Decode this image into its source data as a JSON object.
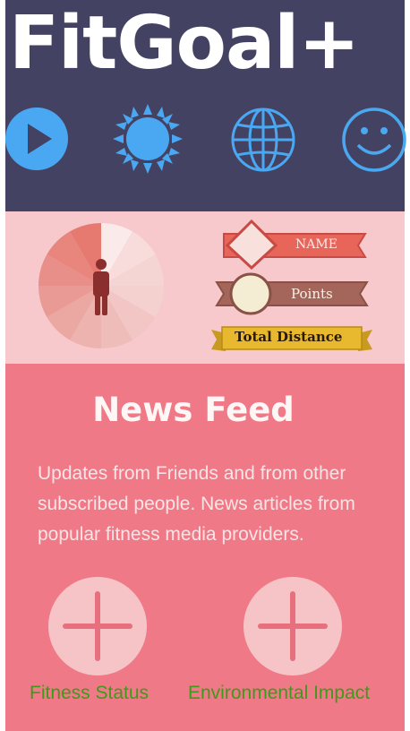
{
  "header": {
    "title": "FitGoal+",
    "icons": [
      "play-icon",
      "sun-icon",
      "globe-icon",
      "smiley-icon"
    ]
  },
  "profile": {
    "avatar_icon": "person-icon",
    "name_label": "NAME",
    "points_label": "Points",
    "distance_label": "Total Distance"
  },
  "feed": {
    "title": "News Feed",
    "description": "Updates from Friends and  from other subscribed people. News articles from popular fitness media providers."
  },
  "actions": {
    "fitness_label": "Fitness Status",
    "environment_label": "Environmental Impact"
  },
  "colors": {
    "header_bg": "#444262",
    "icon_blue": "#4aa8f2",
    "profile_bg": "#f7c9cc",
    "feed_bg": "#ef7986",
    "label_green": "#3e9a1b"
  }
}
